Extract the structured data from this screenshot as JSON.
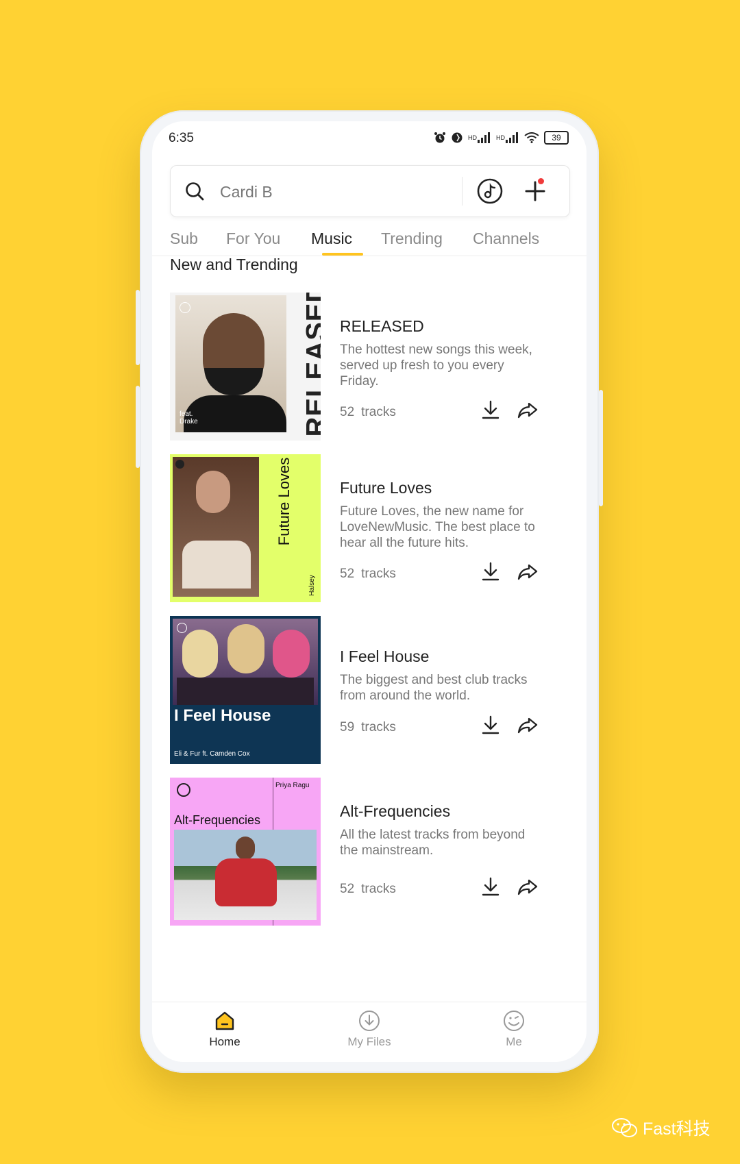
{
  "status_bar": {
    "time": "6:35",
    "battery": "39",
    "hd1": "HD",
    "hd2": "HD"
  },
  "search": {
    "value": "Cardi B"
  },
  "tabs": [
    {
      "label": "Sub"
    },
    {
      "label": "For You"
    },
    {
      "label": "Music"
    },
    {
      "label": "Trending"
    },
    {
      "label": "Channels"
    }
  ],
  "active_tab": "Music",
  "section": {
    "title": "New and Trending"
  },
  "playlists": [
    {
      "title": "RELEASED",
      "description": "The hottest new songs this week, served up fresh to you every Friday.",
      "count": "52",
      "count_label": "tracks",
      "cover": {
        "text": "RELEASED",
        "sub": "feat.\nDrake",
        "bg": "#f4f4f4",
        "accent": "#222222"
      }
    },
    {
      "title": "Future Loves",
      "description": "Future Loves, the new name for LoveNewMusic. The best place to hear all the future hits.",
      "count": "52",
      "count_label": "tracks",
      "cover": {
        "text": "Future Loves",
        "sub": "Halsey",
        "bg": "#E3FF6A",
        "accent": "#111111"
      }
    },
    {
      "title": "I Feel House",
      "description": "The biggest and best club tracks from around the world.",
      "count": "59",
      "count_label": "tracks",
      "cover": {
        "text": "I Feel House",
        "sub": "Eli & Fur ft. Camden Cox",
        "bg": "#0E3554",
        "accent": "#ffffff"
      }
    },
    {
      "title": "Alt-Frequencies",
      "description": "All the latest tracks from beyond the mainstream.",
      "count": "52",
      "count_label": "tracks",
      "cover": {
        "text": "Alt-Frequencies",
        "sub": "Priya Ragu",
        "bg": "#F7A6F5",
        "accent": "#111111"
      }
    }
  ],
  "bottom_nav": [
    {
      "label": "Home"
    },
    {
      "label": "My Files"
    },
    {
      "label": "Me"
    }
  ],
  "watermark": {
    "text": "Fast科技"
  },
  "colors": {
    "background": "#FFD233",
    "accent": "#FFC41F",
    "notification": "#F03A3A"
  }
}
